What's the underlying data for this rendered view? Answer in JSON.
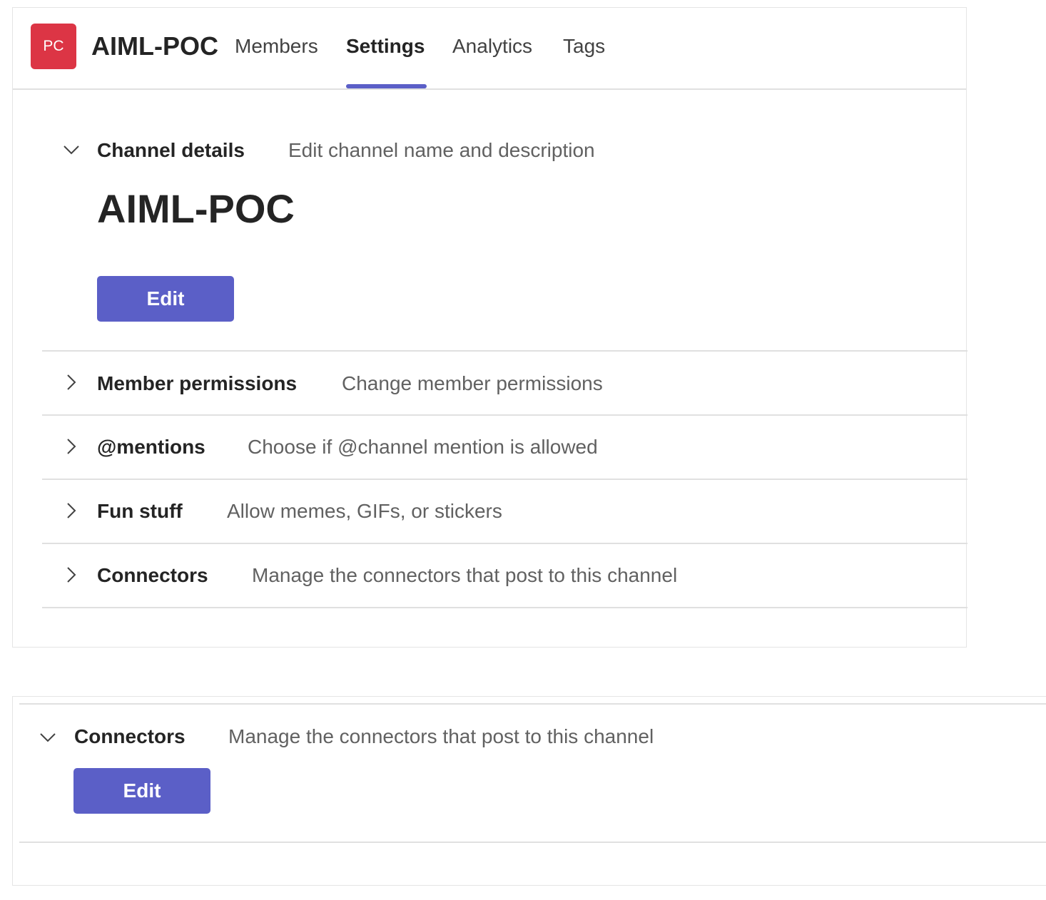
{
  "header": {
    "avatar_initials": "PC",
    "avatar_color": "#dc3545",
    "team_name": "AIML-POC",
    "tabs": [
      {
        "label": "Members"
      },
      {
        "label": "Settings",
        "active": true
      },
      {
        "label": "Analytics"
      },
      {
        "label": "Tags"
      }
    ],
    "accent_color": "#5b5fc7"
  },
  "channel_details": {
    "title": "Channel details",
    "description": "Edit channel name and description",
    "channel_name": "AIML-POC",
    "edit_label": "Edit",
    "expanded": true
  },
  "sections": [
    {
      "title": "Member permissions",
      "description": "Change member permissions",
      "expanded": false
    },
    {
      "title": "@mentions",
      "description": "Choose if @channel mention is allowed",
      "expanded": false
    },
    {
      "title": "Fun stuff",
      "description": "Allow memes, GIFs, or stickers",
      "expanded": false
    },
    {
      "title": "Connectors",
      "description": "Manage the connectors that post to this channel",
      "expanded": false
    }
  ],
  "connectors_expanded": {
    "title": "Connectors",
    "description": "Manage the connectors that post to this channel",
    "edit_label": "Edit",
    "expanded": true
  }
}
